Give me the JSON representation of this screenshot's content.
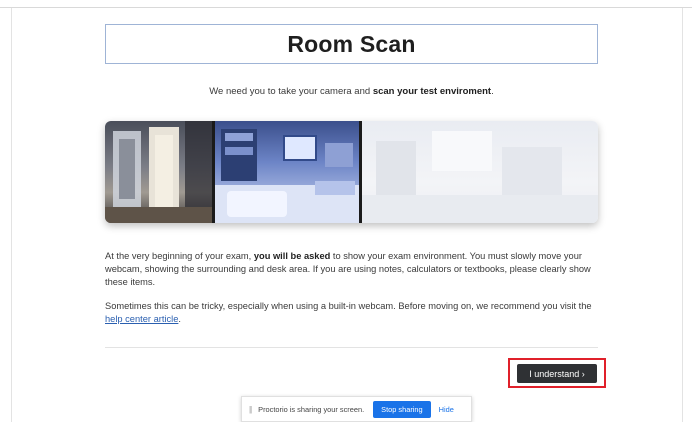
{
  "page": {
    "title": "Room Scan",
    "intro_prefix": "We need you to take your camera and ",
    "intro_bold": "scan your test enviroment",
    "intro_suffix": "."
  },
  "instructions": {
    "p1_start": "At the very beginning of your exam, ",
    "p1_bold": "you will be asked",
    "p1_end": " to show your exam environment. You must slowly move your webcam, showing the surrounding and desk area. If you are using notes, calculators or textbooks, please clearly show these items.",
    "p2_start": "Sometimes this can be tricky, especially when using a built-in webcam. Before moving on, we recommend you visit the ",
    "p2_link": "help center article",
    "p2_end": "."
  },
  "actions": {
    "understand_label": "I understand ›",
    "highlight_color": "#e0202a"
  },
  "share_bar": {
    "grip": "||",
    "message": "Proctorio is sharing your screen.",
    "stop_label": "Stop sharing",
    "hide_label": "Hide",
    "accent_color": "#1a73e8"
  }
}
